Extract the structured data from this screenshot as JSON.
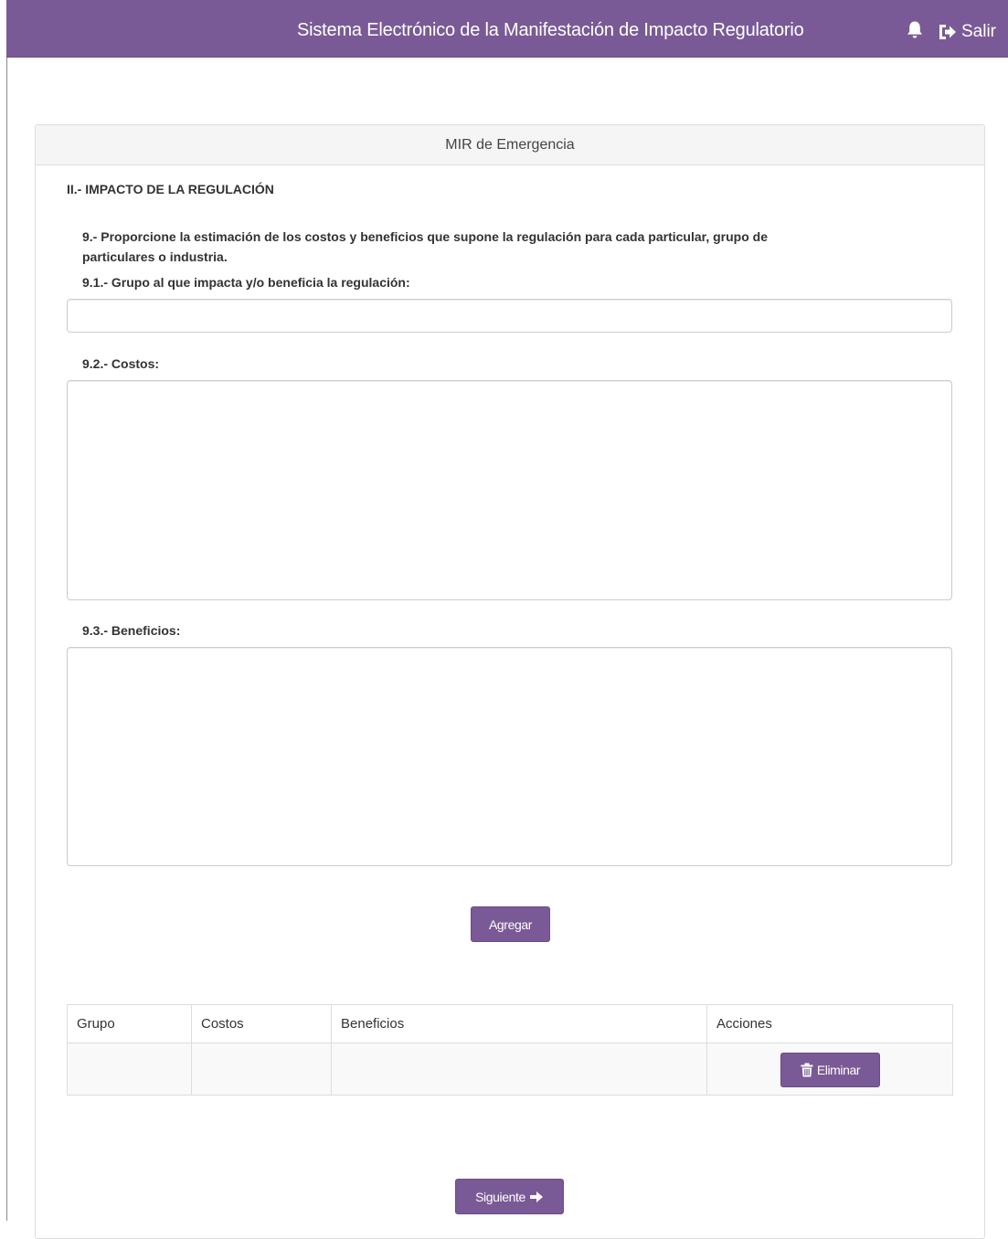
{
  "header": {
    "title": "Sistema Electrónico de la Manifestación de Impacto Regulatorio",
    "bell_icon": "bell-icon",
    "logout_icon": "sign-out-icon",
    "logout_label": "Salir",
    "color": "#7a5a96"
  },
  "panel": {
    "heading": "MIR de Emergencia",
    "section_title": "II.- IMPACTO DE LA REGULACIÓN",
    "question_9_line1": "9.- Proporcione la estimación de los costos y beneficios que supone la regulación para cada particular, grupo de",
    "question_9_line2": "particulares o industria.",
    "label_9_1": "9.1.- Grupo al que impacta y/o beneficia la regulación:",
    "grupo_value": "",
    "label_9_2": "9.2.- Costos:",
    "costos_value": "",
    "label_9_3": "9.3.- Beneficios:",
    "beneficios_value": "",
    "add_button": "Agregar",
    "table": {
      "headers": [
        "Grupo",
        "Costos",
        "Beneficios",
        "Acciones"
      ],
      "rows": [
        {
          "grupo": "",
          "costos": "",
          "beneficios": "",
          "action_label": "Eliminar"
        }
      ]
    },
    "next_button": "Siguiente"
  }
}
